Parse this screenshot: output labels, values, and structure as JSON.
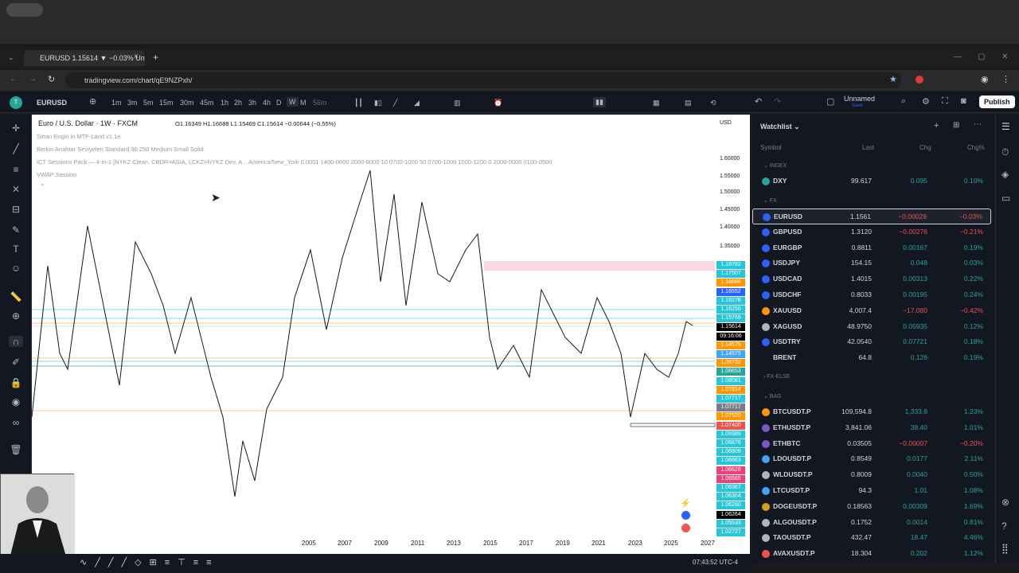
{
  "browser": {
    "tab_title": "EURUSD 1.15614 ▼ −0.03% Un",
    "url": "tradingview.com/chart/qE9NZPxh/"
  },
  "toolbar": {
    "symbol": "EURUSD",
    "intervals": [
      "1m",
      "3m",
      "5m",
      "15m",
      "30m",
      "45m",
      "1h",
      "2h",
      "3h",
      "4h",
      "D",
      "W",
      "M",
      "56m"
    ],
    "layout_name": "Unnamed",
    "layout_sub": "Save",
    "publish": "Publish"
  },
  "chart": {
    "title": "Euro / U.S. Dollar · 1W · FXCM",
    "ohlc": "O1.16349 H1.16688 L1.15469 C1.15614 −0.00644 (−0.55%)",
    "currency": "USD",
    "indicators": [
      "Sinan Engin in MTF-Land v1.1e",
      "Berkin Anahtar Seviyeleri Standard 30 250 Medium Small Solid",
      "ICT Sessions Pack — 4-in-1 [NYKZ Clean, CBDR=ASIA, LCKZ=NYKZ Dev, A... America/New_York 0.0001 1400-0000 2000-0000 10 0700-1000 50 0700-1000 1000-1200 0 2000-0000 0100-0500",
      "VWAP Session"
    ],
    "y_ticks": [
      "1.60000",
      "1.55000",
      "1.50000",
      "1.45000",
      "1.40000",
      "1.35000"
    ],
    "x_ticks": [
      "2005",
      "2007",
      "2009",
      "2011",
      "2013",
      "2015",
      "2017",
      "2019",
      "2021",
      "2023",
      "2025",
      "2027"
    ],
    "price_labels": [
      {
        "v": "1.18782",
        "c": "#26c6da"
      },
      {
        "v": "1.17507",
        "c": "#26c6da"
      },
      {
        "v": "1.16686",
        "c": "#ff9800"
      },
      {
        "v": "1.16552",
        "c": "#2962ff"
      },
      {
        "v": "1.16278",
        "c": "#26c6da"
      },
      {
        "v": "1.16250",
        "c": "#26c6da"
      },
      {
        "v": "1.15769",
        "c": "#26c6da"
      },
      {
        "v": "1.15614",
        "c": "#000000"
      },
      {
        "v": "09:16:06",
        "c": "#000000"
      },
      {
        "v": "1.14575",
        "c": "#ff9800"
      },
      {
        "v": "1.14575",
        "c": "#42a5f5"
      },
      {
        "v": "1.08732",
        "c": "#ff9800"
      },
      {
        "v": "1.08653",
        "c": "#26a69a"
      },
      {
        "v": "1.08081",
        "c": "#26c6da"
      },
      {
        "v": "1.07814",
        "c": "#ff9800"
      },
      {
        "v": "1.07717",
        "c": "#26c6da"
      },
      {
        "v": "1.07717",
        "c": "#787b86"
      },
      {
        "v": "1.07520",
        "c": "#ff9800"
      },
      {
        "v": "1.07400",
        "c": "#ef5350"
      },
      {
        "v": "1.06989",
        "c": "#26c6da"
      },
      {
        "v": "1.06876",
        "c": "#26c6da"
      },
      {
        "v": "1.06809",
        "c": "#26c6da"
      },
      {
        "v": "1.06663",
        "c": "#26c6da"
      },
      {
        "v": "1.06628",
        "c": "#ec407a"
      },
      {
        "v": "1.06565",
        "c": "#ec407a"
      },
      {
        "v": "1.06367",
        "c": "#26c6da"
      },
      {
        "v": "1.06304",
        "c": "#26c6da"
      },
      {
        "v": "1.06280",
        "c": "#26c6da"
      },
      {
        "v": "1.06264",
        "c": "#000000"
      },
      {
        "v": "1.05533",
        "c": "#26c6da"
      },
      {
        "v": "1.02727",
        "c": "#26c6da"
      }
    ],
    "time_readout": "07:43:52 UTC-4"
  },
  "watchlist": {
    "title": "Watchlist",
    "cols": {
      "symbol": "Symbol",
      "last": "Last",
      "chg": "Chg",
      "pct": "Chg%"
    },
    "sections": {
      "index": "INDEX",
      "fx": "FX",
      "fxelse": "FX-ELSE",
      "bag": "BAG"
    },
    "index": [
      {
        "sym": "DXY",
        "last": "99.617",
        "chg": "0.095",
        "pct": "0.10%",
        "up": true,
        "ic": "#26a69a"
      }
    ],
    "fx": [
      {
        "sym": "EURUSD",
        "last": "1.1561",
        "chg": "−0.00029",
        "pct": "−0.03%",
        "up": false,
        "ic": "#2962ff"
      },
      {
        "sym": "GBPUSD",
        "last": "1.3120",
        "chg": "−0.00276",
        "pct": "−0.21%",
        "up": false,
        "ic": "#2962ff"
      },
      {
        "sym": "EURGBP",
        "last": "0.8811",
        "chg": "0.00167",
        "pct": "0.19%",
        "up": true,
        "ic": "#2962ff"
      },
      {
        "sym": "USDJPY",
        "last": "154.15",
        "chg": "0.048",
        "pct": "0.03%",
        "up": true,
        "ic": "#2962ff"
      },
      {
        "sym": "USDCAD",
        "last": "1.4015",
        "chg": "0.00313",
        "pct": "0.22%",
        "up": true,
        "ic": "#2962ff"
      },
      {
        "sym": "USDCHF",
        "last": "0.8033",
        "chg": "0.00195",
        "pct": "0.24%",
        "up": true,
        "ic": "#2962ff"
      },
      {
        "sym": "XAUUSD",
        "last": "4,007.4",
        "chg": "−17.080",
        "pct": "−0.42%",
        "up": false,
        "ic": "#ff9800"
      },
      {
        "sym": "XAGUSD",
        "last": "48.9750",
        "chg": "0.05935",
        "pct": "0.12%",
        "up": true,
        "ic": "#b2b5be"
      },
      {
        "sym": "USDTRY",
        "last": "42.0540",
        "chg": "0.07721",
        "pct": "0.18%",
        "up": true,
        "ic": "#2962ff"
      },
      {
        "sym": "BRENT",
        "last": "64.8",
        "chg": "0.126",
        "pct": "0.19%",
        "up": true,
        "ic": "#131722"
      }
    ],
    "bag": [
      {
        "sym": "BTCUSDT.P",
        "last": "109,594.8",
        "chg": "1,333.8",
        "pct": "1.23%",
        "up": true,
        "ic": "#ff9800"
      },
      {
        "sym": "ETHUSDT.P",
        "last": "3,841.06",
        "chg": "38.40",
        "pct": "1.01%",
        "up": true,
        "ic": "#7e57c2"
      },
      {
        "sym": "ETHBTC",
        "last": "0.03505",
        "chg": "−0.00007",
        "pct": "−0.20%",
        "up": false,
        "ic": "#7e57c2"
      },
      {
        "sym": "LDOUSDT.P",
        "last": "0.8549",
        "chg": "0.0177",
        "pct": "2.11%",
        "up": true,
        "ic": "#42a5f5"
      },
      {
        "sym": "WLDUSDT.P",
        "last": "0.8009",
        "chg": "0.0040",
        "pct": "0.50%",
        "up": true,
        "ic": "#b2b5be"
      },
      {
        "sym": "LTCUSDT.P",
        "last": "94.3",
        "chg": "1.01",
        "pct": "1.08%",
        "up": true,
        "ic": "#42a5f5"
      },
      {
        "sym": "DOGEUSDT.P",
        "last": "0.18563",
        "chg": "0.00309",
        "pct": "1.69%",
        "up": true,
        "ic": "#d4a017"
      },
      {
        "sym": "ALGOUSDT.P",
        "last": "0.1752",
        "chg": "0.0014",
        "pct": "0.81%",
        "up": true,
        "ic": "#b2b5be"
      },
      {
        "sym": "TAOUSDT.P",
        "last": "432.47",
        "chg": "18.47",
        "pct": "4.46%",
        "up": true,
        "ic": "#b2b5be"
      },
      {
        "sym": "AVAXUSDT.P",
        "last": "18.304",
        "chg": "0.202",
        "pct": "1.12%",
        "up": true,
        "ic": "#ef5350"
      }
    ]
  }
}
